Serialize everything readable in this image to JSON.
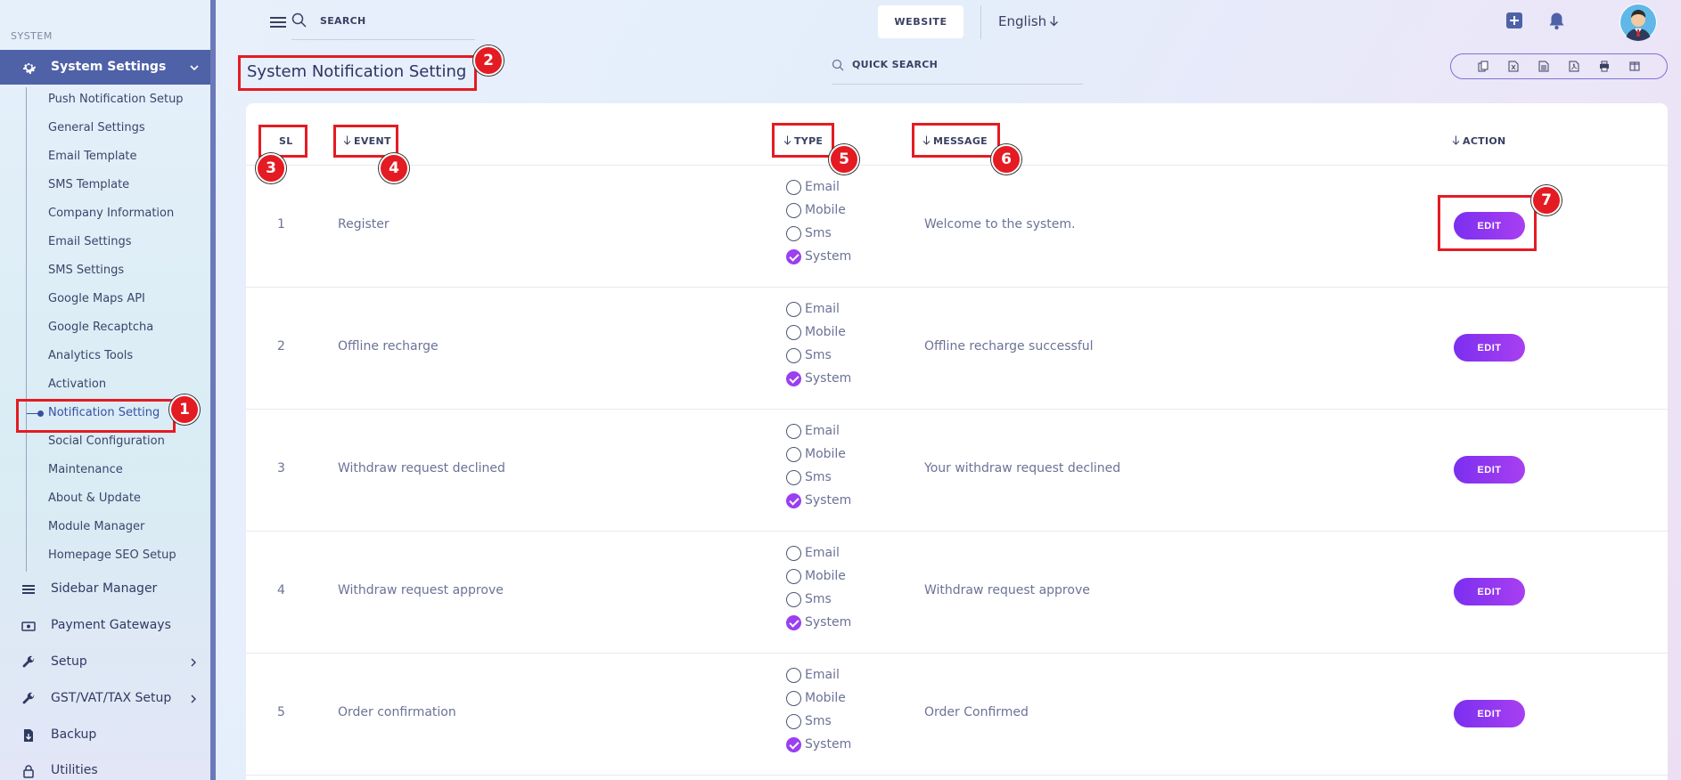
{
  "sidebar": {
    "group_label": "SYSTEM",
    "active_parent": "System Settings",
    "sub_items": [
      "Push Notification Setup",
      "General Settings",
      "Email Template",
      "SMS Template",
      "Company Information",
      "Email Settings",
      "SMS Settings",
      "Google Maps API",
      "Google Recaptcha",
      "Analytics Tools",
      "Activation",
      "Notification Setting",
      "Social Configuration",
      "Maintenance",
      "About & Update",
      "Module Manager",
      "Homepage SEO Setup"
    ],
    "current_sub_item": "Notification Setting",
    "main_items": [
      {
        "label": "Sidebar Manager",
        "icon": "menu-lines-icon"
      },
      {
        "label": "Payment Gateways",
        "icon": "money-icon"
      },
      {
        "label": "Setup",
        "icon": "wrench-icon",
        "has_submenu": true
      },
      {
        "label": "GST/VAT/TAX Setup",
        "icon": "wrench-icon",
        "has_submenu": true
      },
      {
        "label": "Backup",
        "icon": "download-file-icon"
      },
      {
        "label": "Utilities",
        "icon": "lock-icon"
      }
    ]
  },
  "topbar": {
    "search_placeholder": "SEARCH",
    "website_label": "WEBSITE",
    "language": "English"
  },
  "page": {
    "title": "System Notification Setting",
    "quick_search_placeholder": "QUICK SEARCH"
  },
  "export_buttons": [
    "copy-icon",
    "excel-icon",
    "csv-icon",
    "pdf-icon",
    "print-icon",
    "columns-icon"
  ],
  "table": {
    "headers": {
      "sl": "SL",
      "event": "EVENT",
      "type": "TYPE",
      "message": "MESSAGE",
      "action": "ACTION"
    },
    "type_options": [
      "Email",
      "Mobile",
      "Sms",
      "System"
    ],
    "edit_label": "EDIT",
    "rows": [
      {
        "sl": "1",
        "event": "Register",
        "message": "Welcome to the system.",
        "checked": "System"
      },
      {
        "sl": "2",
        "event": "Offline recharge",
        "message": "Offline recharge successful",
        "checked": "System"
      },
      {
        "sl": "3",
        "event": "Withdraw request declined",
        "message": "Your withdraw request declined",
        "checked": "System"
      },
      {
        "sl": "4",
        "event": "Withdraw request approve",
        "message": "Withdraw request approve",
        "checked": "System"
      },
      {
        "sl": "5",
        "event": "Order confirmation",
        "message": "Order Confirmed",
        "checked": "System"
      }
    ]
  },
  "annotations": [
    "1",
    "2",
    "3",
    "4",
    "5",
    "6",
    "7"
  ],
  "colors": {
    "sidebar_active": "#4f62a8",
    "accent_purple": "#9b3ff0",
    "annotation_red": "#e41b23"
  }
}
